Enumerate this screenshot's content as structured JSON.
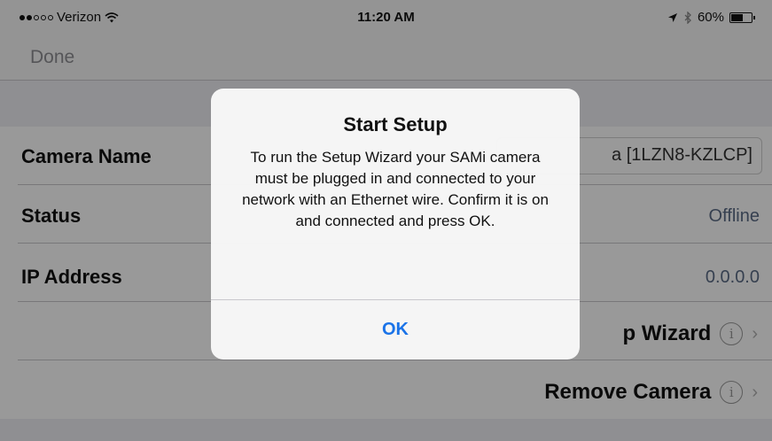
{
  "status_bar": {
    "carrier": "Verizon",
    "signal_full": 2,
    "signal_total": 5,
    "time": "11:20 AM",
    "battery_percent": "60%",
    "battery_level": 0.6
  },
  "nav": {
    "done_label": "Done"
  },
  "rows": {
    "camera_name": {
      "label": "Camera Name",
      "value": "a [1LZN8-KZLCP]"
    },
    "status": {
      "label": "Status",
      "value": "Offline"
    },
    "ip_address": {
      "label": "IP Address",
      "value": "0.0.0.0"
    },
    "setup_wizard": {
      "label": "p Wizard"
    },
    "remove_camera": {
      "label": "Remove Camera"
    }
  },
  "icons": {
    "info": "i",
    "chevron": "›"
  },
  "alert": {
    "title": "Start Setup",
    "message": "To run the Setup Wizard your SAMi camera must be plugged in and connected to your network with an Ethernet wire.  Confirm it is on and connected and press OK.",
    "ok_label": "OK"
  },
  "colors": {
    "accent": "#1a73e8",
    "value_text": "#5b6b85",
    "dim_overlay": "rgba(0,0,0,0.40)"
  }
}
